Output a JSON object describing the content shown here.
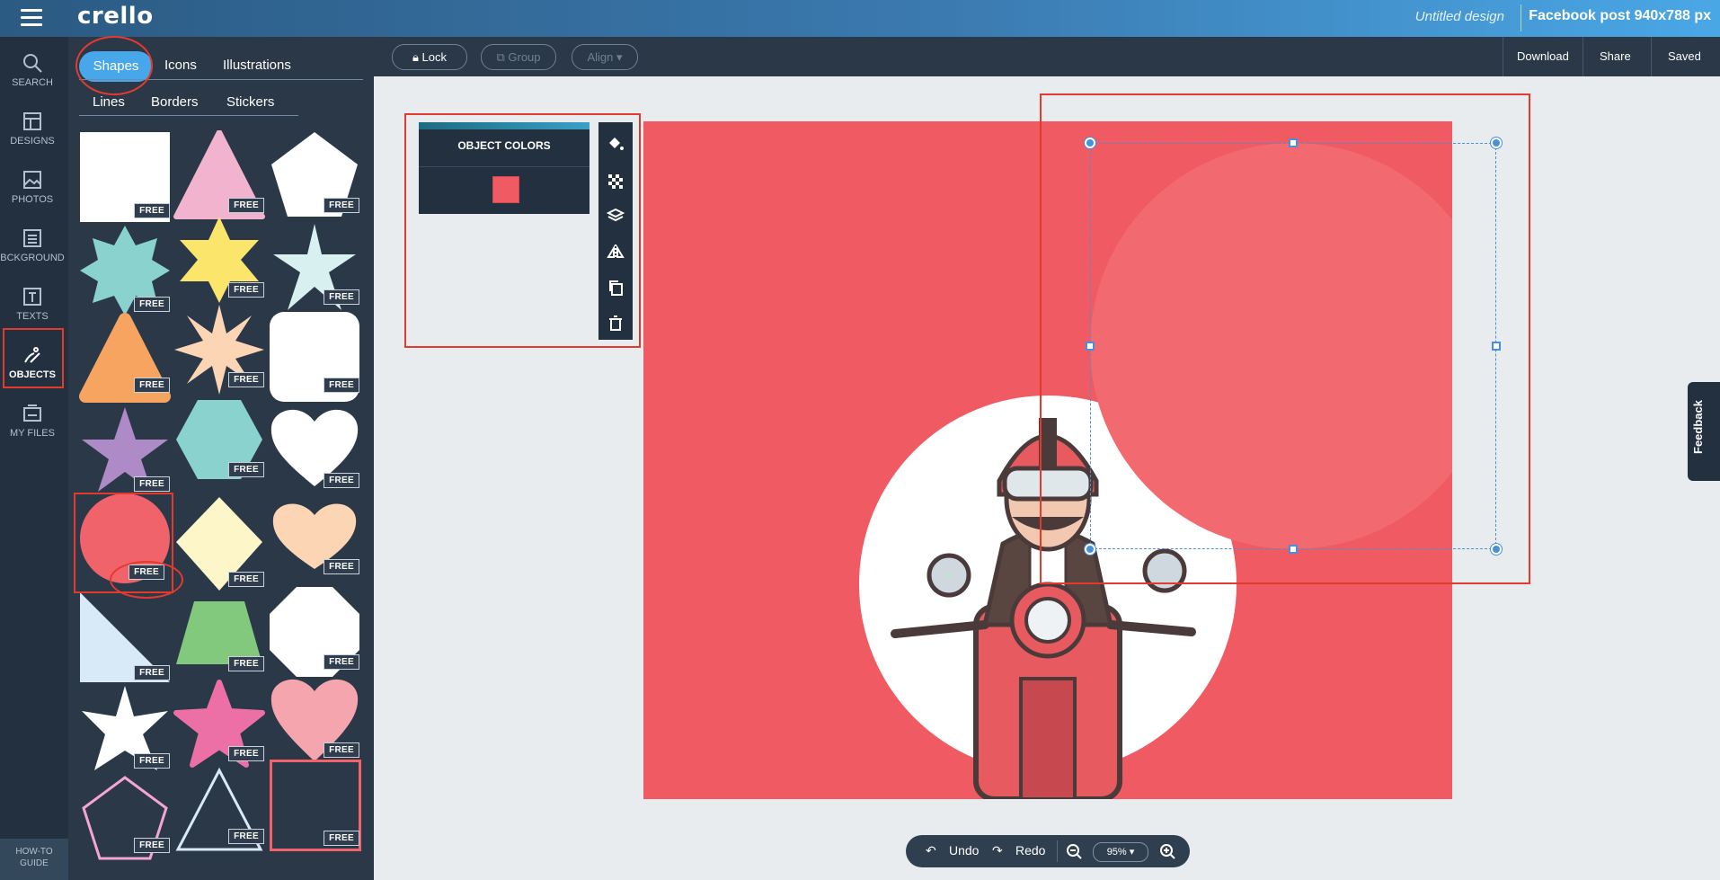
{
  "app": {
    "logo": "crello",
    "design_name": "Untitled design",
    "format_label": "Facebook post 940x788 px"
  },
  "nav": {
    "items": [
      {
        "label": "SEARCH",
        "icon": "search-icon"
      },
      {
        "label": "DESIGNS",
        "icon": "designs-icon"
      },
      {
        "label": "PHOTOS",
        "icon": "photos-icon"
      },
      {
        "label": "BCKGROUND",
        "icon": "background-icon"
      },
      {
        "label": "TEXTS",
        "icon": "texts-icon"
      },
      {
        "label": "OBJECTS",
        "icon": "objects-icon",
        "active": true
      },
      {
        "label": "MY FILES",
        "icon": "my-files-icon"
      }
    ],
    "howto_line1": "HOW-TO",
    "howto_line2": "GUIDE"
  },
  "panel": {
    "tabs": [
      "Shapes",
      "Icons",
      "Illustrations"
    ],
    "subtabs": [
      "Lines",
      "Borders",
      "Stickers"
    ],
    "free_badge": "FREE",
    "shapes": [
      "square",
      "triangle",
      "pentagon",
      "star-8",
      "star-6",
      "star-6-thin",
      "rounded-triangle",
      "star-8-sharp",
      "rounded-square",
      "star-5",
      "hexagon",
      "heart",
      "circle",
      "diamond",
      "heart",
      "octagon",
      "right-triangle",
      "trapezoid",
      "octagon",
      "star-6",
      "star-5",
      "heart",
      "pentagon-outline",
      "triangle-outline",
      "square-outline"
    ],
    "shape_colors": {
      "white": "#ffffff",
      "pink": "#f2b3cf",
      "teal": "#8ad2cd",
      "yellow": "#fbe56a",
      "lightblue": "#d9f0f0",
      "orange": "#f7a460",
      "peach": "#fcd5b5",
      "purple": "#ae8bc7",
      "red": "#f0636a",
      "cream": "#fdf6c8",
      "green": "#82c97e",
      "magenta": "#ec6fa6",
      "rose": "#f4a5ad",
      "sky": "#d8eaf7"
    }
  },
  "toolbar": {
    "lock": "Lock",
    "group": "Group",
    "align": "Align",
    "download": "Download",
    "share": "Share",
    "saved": "Saved"
  },
  "color_panel": {
    "title": "OBJECT COLORS",
    "swatch_color": "#f05a62"
  },
  "tools": [
    "fill-icon",
    "transparency-icon",
    "layers-icon",
    "flip-icon",
    "duplicate-icon",
    "trash-icon"
  ],
  "canvas": {
    "background_color": "#f05a62",
    "selected_shape_color": "#f2696f"
  },
  "feedback": "Feedback",
  "bottom": {
    "undo": "Undo",
    "redo": "Redo",
    "zoom": "95%"
  }
}
